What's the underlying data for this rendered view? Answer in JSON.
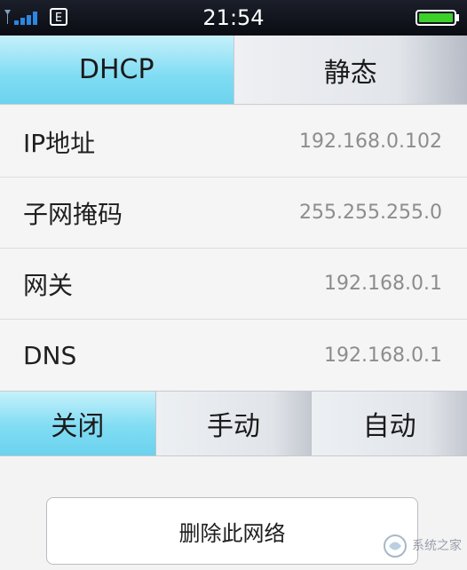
{
  "status_bar": {
    "time": "21:54",
    "sim_glyph": "E",
    "icons": [
      "signal-icon",
      "sim-icon",
      "battery-icon"
    ],
    "battery_color": "#3bd02a"
  },
  "mode_tabs": [
    {
      "label": "DHCP",
      "active": true
    },
    {
      "label": "静态",
      "active": false
    }
  ],
  "settings": [
    {
      "label": "IP地址",
      "value": "192.168.0.102"
    },
    {
      "label": "子网掩码",
      "value": "255.255.255.0"
    },
    {
      "label": "网关",
      "value": "192.168.0.1"
    },
    {
      "label": "DNS",
      "value": "192.168.0.1"
    }
  ],
  "proxy_segments": [
    {
      "label": "关闭",
      "active": true
    },
    {
      "label": "手动",
      "active": false
    },
    {
      "label": "自动",
      "active": false
    }
  ],
  "delete_button": {
    "label": "删除此网络"
  },
  "watermark": {
    "text": "系统之家"
  },
  "colors": {
    "accent": "#7fdcf3",
    "status_bar": "#12151d"
  }
}
